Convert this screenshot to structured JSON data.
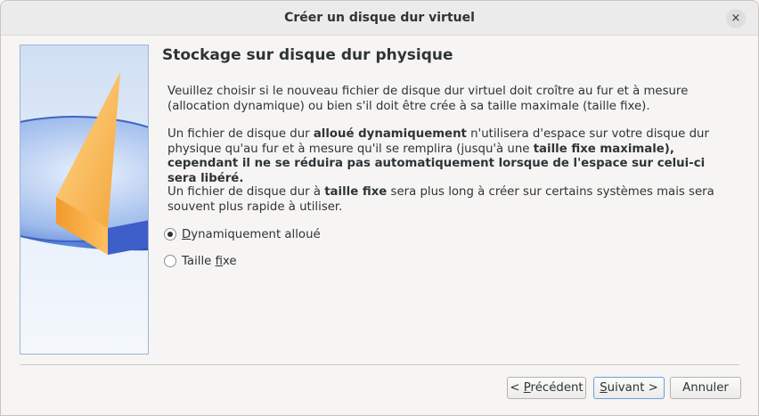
{
  "window": {
    "title": "Créer un disque dur virtuel",
    "close_glyph": "×"
  },
  "page": {
    "heading": "Stockage sur disque dur physique",
    "paragraph1": "Veuillez choisir si le nouveau fichier de disque dur virtuel doit croître au fur et à mesure (allocation dynamique) ou bien s'il doit être crée à sa taille maximale (taille fixe).",
    "paragraph2": {
      "part1": "Un fichier de disque dur ",
      "bold1": "alloué dynamiquement",
      "part2": " n'utilisera d'espace sur votre disque dur physique qu'au fur et à mesure qu'il se remplira (jusqu'à une ",
      "bold2": "taille fixe maximale), cependant il ne se réduira pas automatiquement lorsque de l'espace sur celui-ci sera libéré."
    },
    "paragraph3": {
      "part1": "Un fichier de disque dur à ",
      "bold1": "taille fixe",
      "part2": " sera plus long à créer sur certains systèmes mais sera souvent plus rapide à utiliser."
    }
  },
  "options": [
    {
      "label_mnemonic": "D",
      "label_rest": "ynamiquement alloué",
      "checked": true
    },
    {
      "label_before": "Taille ",
      "label_mnemonic": "f",
      "label_rest": "ixe",
      "checked": false
    }
  ],
  "buttons": {
    "previous_before": "< ",
    "previous_mnemonic": "P",
    "previous_rest": "récédent",
    "next_mnemonic": "S",
    "next_rest": "uivant >",
    "cancel": "Annuler"
  },
  "icons": {
    "close": "close-icon",
    "disk_illustration": "disk-pie-icon"
  }
}
